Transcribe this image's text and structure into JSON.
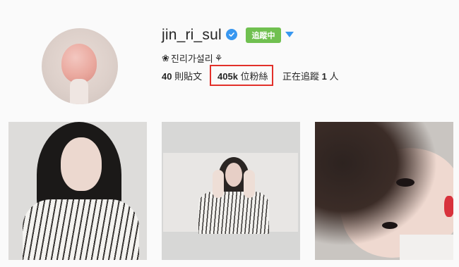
{
  "profile": {
    "username": "jin_ri_sul",
    "follow_label": "追蹤中",
    "bio": "진리가설리",
    "colors": {
      "verified": "#3897f0",
      "follow": "#70c050",
      "highlight": "#e2302a"
    }
  },
  "stats": {
    "posts_count": "40",
    "posts_label": "則貼文",
    "followers_count": "405k",
    "followers_label": "位粉絲",
    "following_prefix": "正在追蹤",
    "following_count": "1",
    "following_suffix": "人"
  },
  "icons": {
    "verified": "check-badge-icon",
    "dropdown": "caret-down-icon",
    "bio_flower": "flower-icon",
    "bio_rose": "rose-icon"
  },
  "posts": [
    {
      "label": "post-1"
    },
    {
      "label": "post-2"
    },
    {
      "label": "post-3"
    }
  ]
}
